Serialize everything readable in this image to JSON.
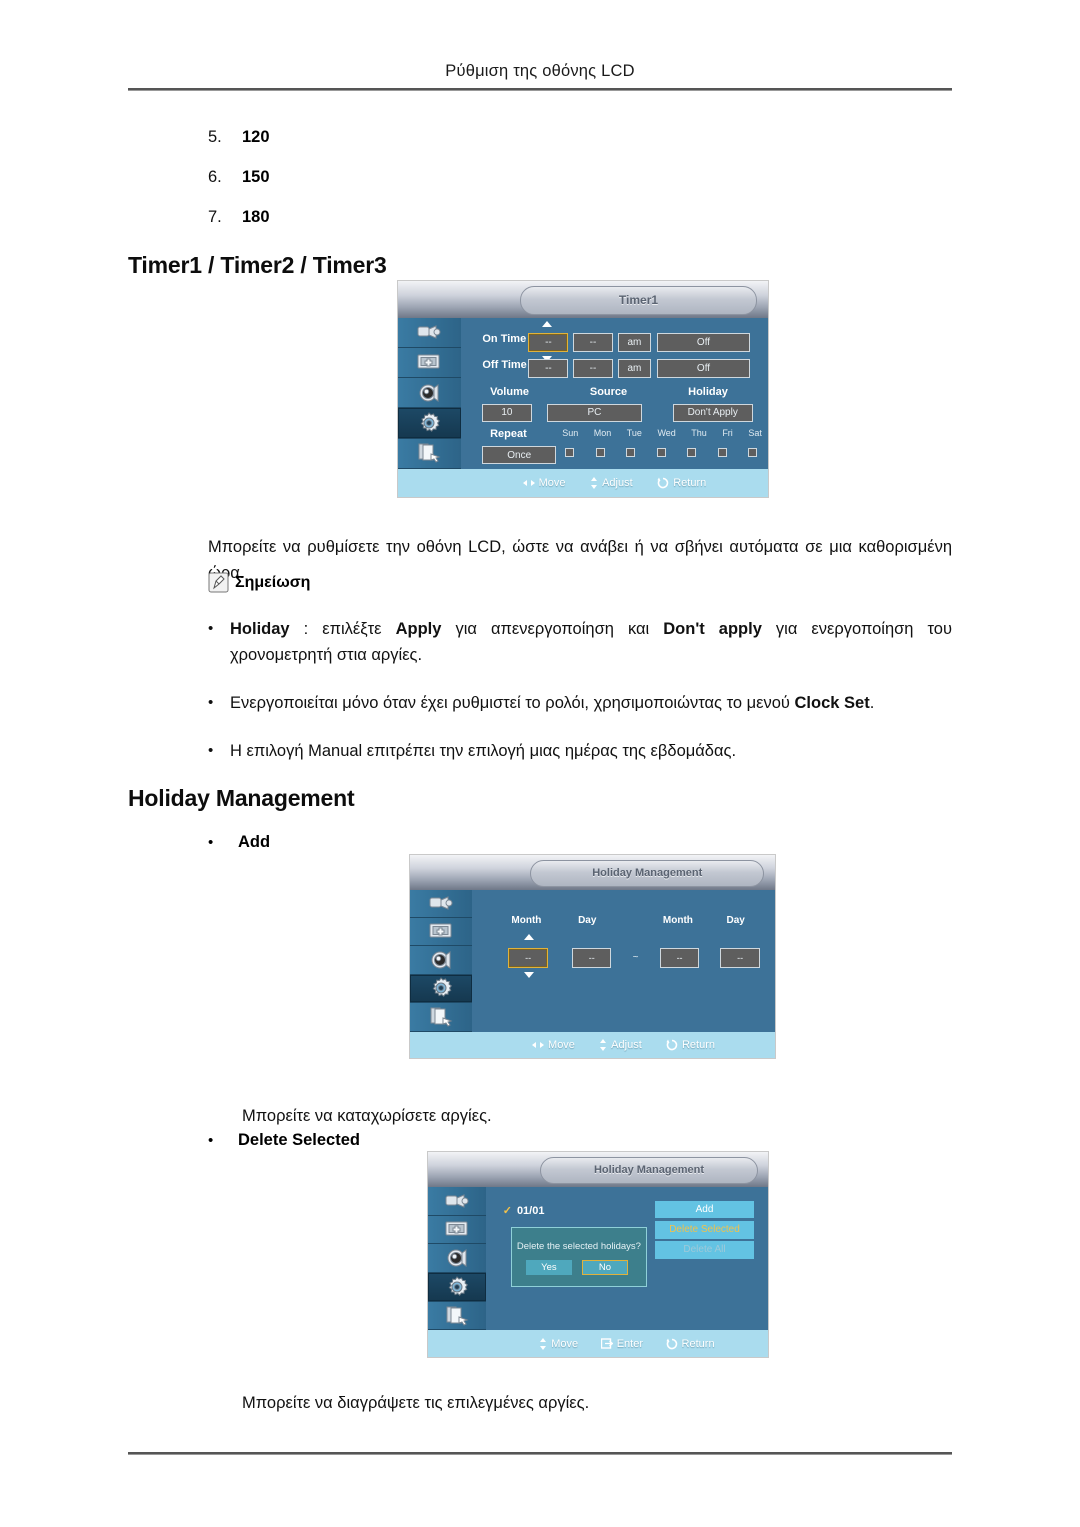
{
  "header": {
    "title": "Ρύθμιση της οθόνης LCD"
  },
  "numbered_list": [
    {
      "num": "5.",
      "value": "120"
    },
    {
      "num": "6.",
      "value": "150"
    },
    {
      "num": "7.",
      "value": "180"
    }
  ],
  "sections": {
    "timer": {
      "heading": "Timer1 / Timer2 / Timer3",
      "paragraph": "Μπορείτε να ρυθμίσετε την οθόνη LCD, ώστε να ανάβει ή να σβήνει αυτόματα σε μια καθορισμένη ώρα.",
      "note_label": "Σημείωση",
      "bullets": [
        {
          "dot": "•",
          "parts": [
            {
              "text": "Holiday",
              "bold": true
            },
            {
              "text": " : επιλέξτε ",
              "bold": false
            },
            {
              "text": "Apply",
              "bold": true
            },
            {
              "text": " για απενεργοποίηση και ",
              "bold": false
            },
            {
              "text": "Don't apply",
              "bold": true
            },
            {
              "text": " για ενεργοποίηση του χρονομετρητή στια αργίες.",
              "bold": false
            }
          ]
        },
        {
          "dot": "•",
          "parts": [
            {
              "text": "Ενεργοποιείται μόνο όταν έχει ρυθμιστεί το ρολόι, χρησιμοποιώντας το μενού ",
              "bold": false
            },
            {
              "text": "Clock Set",
              "bold": true
            },
            {
              "text": ".",
              "bold": false
            }
          ]
        },
        {
          "dot": "•",
          "parts": [
            {
              "text": "Η επιλογή Manual επιτρέπει την επιλογή μιας ημέρας της εβδομάδας.",
              "bold": false
            }
          ]
        }
      ]
    },
    "holiday": {
      "heading": "Holiday Management",
      "add_bullet": {
        "dot": "•",
        "label": "Add"
      },
      "add_paragraph": "Μπορείτε να καταχωρίσετε αργίες.",
      "delete_bullet": {
        "dot": "•",
        "label": "Delete Selected"
      },
      "delete_paragraph": "Μπορείτε να διαγράψετε τις επιλεγμένες αργίες."
    }
  },
  "osd_timer": {
    "title": "Timer1",
    "sidebar_icons": [
      "input-plug-icon",
      "picture-monitor-icon",
      "sound-speaker-icon",
      "setup-gear-icon",
      "multi-control-icon"
    ],
    "rows": {
      "on_time_label": "On Time",
      "off_time_label": "Off Time",
      "on_time_hour": "--",
      "on_time_min": "--",
      "on_time_ampm": "am",
      "on_time_state": "Off",
      "off_time_hour": "--",
      "off_time_min": "--",
      "off_time_ampm": "am",
      "off_time_state": "Off"
    },
    "volume_label": "Volume",
    "volume_value": "10",
    "source_label": "Source",
    "source_value": "PC",
    "holiday_label": "Holiday",
    "holiday_value": "Don't Apply",
    "repeat_label": "Repeat",
    "repeat_value": "Once",
    "days": [
      "Sun",
      "Mon",
      "Tue",
      "Wed",
      "Thu",
      "Fri",
      "Sat"
    ],
    "footer": [
      {
        "icon": "move-icon",
        "label": "Move"
      },
      {
        "icon": "adjust-icon",
        "label": "Adjust"
      },
      {
        "icon": "return-icon",
        "label": "Return"
      }
    ]
  },
  "osd_holiday_add": {
    "title": "Holiday Management",
    "month_label_1": "Month",
    "day_label_1": "Day",
    "month_label_2": "Month",
    "day_label_2": "Day",
    "month_value_1": "--",
    "day_value_1": "--",
    "separator": "~",
    "month_value_2": "--",
    "day_value_2": "--",
    "footer": [
      {
        "icon": "move-icon",
        "label": "Move"
      },
      {
        "icon": "adjust-icon",
        "label": "Adjust"
      },
      {
        "icon": "return-icon",
        "label": "Return"
      }
    ]
  },
  "osd_holiday_delete": {
    "title": "Holiday Management",
    "entry_check": "✓",
    "entry_value": "01/01",
    "buttons": [
      {
        "label": "Add",
        "state": "normal"
      },
      {
        "label": "Delete Selected",
        "state": "highlighted"
      },
      {
        "label": "Delete All",
        "state": "disabled"
      }
    ],
    "dialog": {
      "message": "Delete the selected holidays?",
      "yes_label": "Yes",
      "no_label": "No"
    },
    "footer": [
      {
        "icon": "move-icon",
        "label": "Move"
      },
      {
        "icon": "enter-icon",
        "label": "Enter"
      },
      {
        "icon": "return-icon",
        "label": "Return"
      }
    ]
  },
  "colors": {
    "osd_body": "#3d7298",
    "osd_sidebar": "#2f6385",
    "osd_footer": "#aadcee",
    "field": "#5e5e5e",
    "focus_border": "#e0b23c",
    "button": "#63c3e3",
    "highlight_text": "#f2c14b",
    "dialog": "#3d7f8c"
  }
}
